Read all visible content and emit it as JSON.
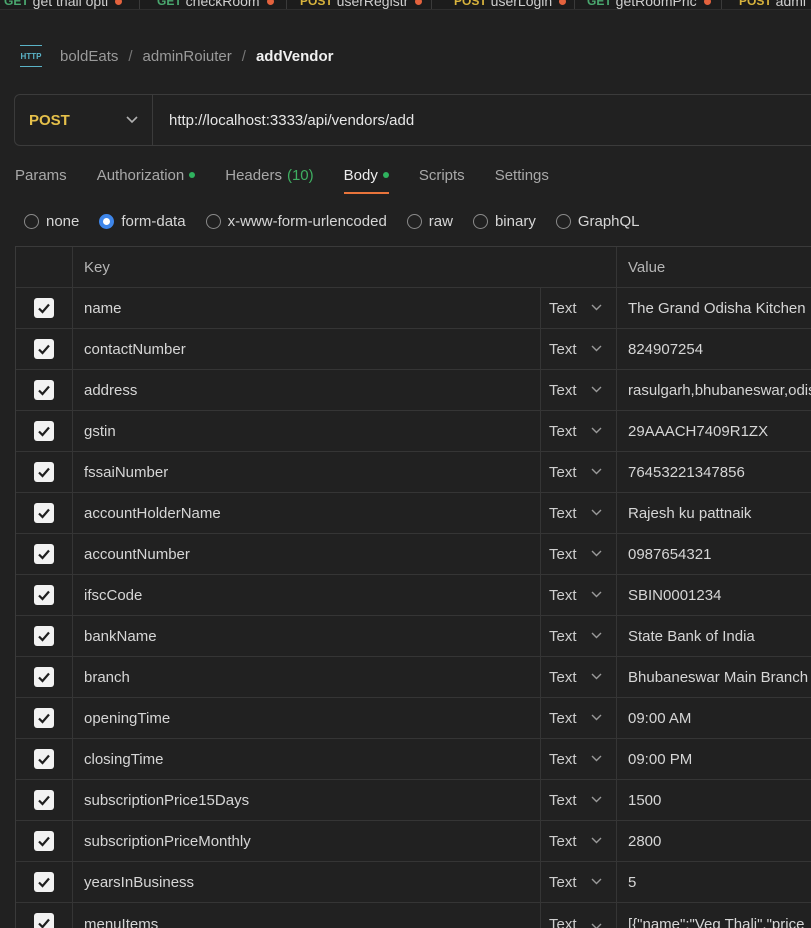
{
  "top_tabs": [
    {
      "method": "GET",
      "name": "get thali opti"
    },
    {
      "method": "GET",
      "name": "checkRoom"
    },
    {
      "method": "POST",
      "name": "userRegistr"
    },
    {
      "method": "POST",
      "name": "userLogin"
    },
    {
      "method": "GET",
      "name": "getRoomPric"
    },
    {
      "method": "POST",
      "name": "admi"
    }
  ],
  "breadcrumb": {
    "icon": "http-icon",
    "icon_text": "HTTP",
    "workspace": "boldEats",
    "folder": "adminRoiuter",
    "request": "addVendor",
    "separator": "/"
  },
  "request": {
    "method": "POST",
    "url": "http://localhost:3333/api/vendors/add"
  },
  "tabs": {
    "params": "Params",
    "authorization": "Authorization",
    "headers": "Headers",
    "headers_count": "(10)",
    "body": "Body",
    "scripts": "Scripts",
    "settings": "Settings"
  },
  "body_types": {
    "none": "none",
    "form_data": "form-data",
    "urlencoded": "x-www-form-urlencoded",
    "raw": "raw",
    "binary": "binary",
    "graphql": "GraphQL",
    "selected": "form-data"
  },
  "table": {
    "key_header": "Key",
    "value_header": "Value",
    "rows": [
      {
        "key": "name",
        "type": "Text",
        "value": "The Grand Odisha Kitchen"
      },
      {
        "key": "contactNumber",
        "type": "Text",
        "value": "824907254"
      },
      {
        "key": "address",
        "type": "Text",
        "value": "rasulgarh,bhubaneswar,odisha"
      },
      {
        "key": "gstin",
        "type": "Text",
        "value": "29AAACH7409R1ZX"
      },
      {
        "key": "fssaiNumber",
        "type": "Text",
        "value": "76453221347856"
      },
      {
        "key": "accountHolderName",
        "type": "Text",
        "value": "Rajesh ku pattnaik"
      },
      {
        "key": "accountNumber",
        "type": "Text",
        "value": "0987654321"
      },
      {
        "key": "ifscCode",
        "type": "Text",
        "value": "SBIN0001234"
      },
      {
        "key": "bankName",
        "type": "Text",
        "value": "State Bank of India"
      },
      {
        "key": "branch",
        "type": "Text",
        "value": "Bhubaneswar Main Branch"
      },
      {
        "key": "openingTime",
        "type": "Text",
        "value": "09:00 AM"
      },
      {
        "key": "closingTime",
        "type": "Text",
        "value": "09:00 PM"
      },
      {
        "key": "subscriptionPrice15Days",
        "type": "Text",
        "value": "1500"
      },
      {
        "key": "subscriptionPriceMonthly",
        "type": "Text",
        "value": "2800"
      },
      {
        "key": "yearsInBusiness",
        "type": "Text",
        "value": "5"
      },
      {
        "key": "menuItems",
        "type": "Text",
        "value": "[{\"name\":\"Veg Thali\",\"price"
      }
    ]
  }
}
